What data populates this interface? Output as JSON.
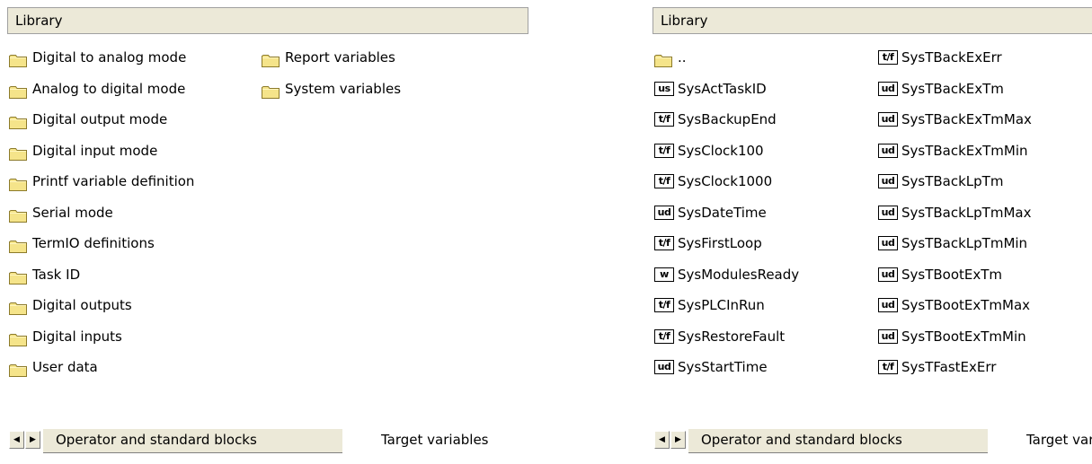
{
  "left_panel": {
    "header": "Library",
    "items": [
      {
        "label": "Digital to analog mode"
      },
      {
        "label": "Analog to digital mode"
      },
      {
        "label": "Digital output mode"
      },
      {
        "label": "Digital input mode"
      },
      {
        "label": "Printf variable definition"
      },
      {
        "label": "Serial mode"
      },
      {
        "label": "TermIO definitions"
      },
      {
        "label": "Task ID"
      },
      {
        "label": "Digital outputs"
      },
      {
        "label": "Digital inputs"
      },
      {
        "label": "User data"
      },
      {
        "label": "Report variables"
      },
      {
        "label": "System variables"
      }
    ],
    "tabs": [
      "Operator and standard blocks",
      "Target variables"
    ]
  },
  "right_panel": {
    "header": "Library",
    "items": [
      {
        "type": "folder",
        "label": ".."
      },
      {
        "type": "us",
        "label": "SysActTaskID"
      },
      {
        "type": "t/f",
        "label": "SysBackupEnd"
      },
      {
        "type": "t/f",
        "label": "SysClock100"
      },
      {
        "type": "t/f",
        "label": "SysClock1000"
      },
      {
        "type": "ud",
        "label": "SysDateTime"
      },
      {
        "type": "t/f",
        "label": "SysFirstLoop"
      },
      {
        "type": "w",
        "label": "SysModulesReady"
      },
      {
        "type": "t/f",
        "label": "SysPLCInRun"
      },
      {
        "type": "t/f",
        "label": "SysRestoreFault"
      },
      {
        "type": "ud",
        "label": "SysStartTime"
      },
      {
        "type": "t/f",
        "label": "SysTBackExErr"
      },
      {
        "type": "ud",
        "label": "SysTBackExTm"
      },
      {
        "type": "ud",
        "label": "SysTBackExTmMax"
      },
      {
        "type": "ud",
        "label": "SysTBackExTmMin"
      },
      {
        "type": "ud",
        "label": "SysTBackLpTm"
      },
      {
        "type": "ud",
        "label": "SysTBackLpTmMax"
      },
      {
        "type": "ud",
        "label": "SysTBackLpTmMin"
      },
      {
        "type": "ud",
        "label": "SysTBootExTm"
      },
      {
        "type": "ud",
        "label": "SysTBootExTmMax"
      },
      {
        "type": "ud",
        "label": "SysTBootExTmMin"
      },
      {
        "type": "t/f",
        "label": "SysTFastExErr"
      }
    ],
    "tabs": [
      "Operator and standard blocks",
      "Target variables"
    ]
  },
  "icons": {
    "folder": "folder-icon",
    "nav_prev": "arrow-left-icon",
    "nav_next": "arrow-right-icon"
  },
  "colors": {
    "header_bg": "#ece9d8",
    "folder_fill": "#f5e48a",
    "folder_stroke": "#8c7a2a"
  }
}
